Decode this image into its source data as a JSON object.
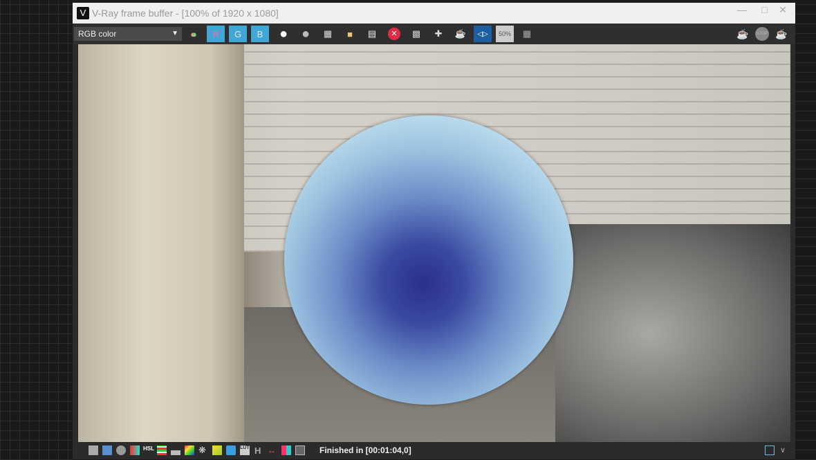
{
  "window": {
    "title": "V-Ray frame buffer - [100% of 1920 x 1080]",
    "logo": "V"
  },
  "toolbar": {
    "channel_select": "RGB color",
    "buttons": [
      {
        "name": "color-channels-icon"
      },
      {
        "name": "R",
        "label": "R"
      },
      {
        "name": "G",
        "label": "G"
      },
      {
        "name": "B",
        "label": "B"
      },
      {
        "name": "white-circle-icon"
      },
      {
        "name": "gray-circle-icon"
      },
      {
        "name": "save-icon"
      },
      {
        "name": "open-folder-icon"
      },
      {
        "name": "clipboard-icon"
      },
      {
        "name": "clear-icon"
      },
      {
        "name": "region-render-icon"
      },
      {
        "name": "follow-mouse-icon"
      },
      {
        "name": "render-teapot-icon"
      },
      {
        "name": "compare-icon"
      },
      {
        "name": "zoom-50-icon",
        "label": "50%"
      },
      {
        "name": "stamp-icon"
      }
    ],
    "right_buttons": [
      "render-icon",
      "stop-icon",
      "interactive-render-icon"
    ],
    "stop_label": "STOP"
  },
  "status": {
    "text": "Finished in [00:01:04,0]",
    "icons": [
      "window-icon",
      "layers-icon",
      "info-icon",
      "color-correction-icon",
      "hsl-icon",
      "levels-icon",
      "histogram-icon",
      "curves-icon",
      "exposure-icon",
      "white-balance-icon",
      "curve-icon",
      "lut-icon",
      "h-icon",
      "lens-icon",
      "lens-effects-icon",
      "denoise-icon"
    ],
    "hsl_label": "HSL",
    "lut_label": "LUT",
    "h_label": "H"
  },
  "colors": {
    "accent": "#3fa7d6",
    "clear": "#e02c43"
  }
}
